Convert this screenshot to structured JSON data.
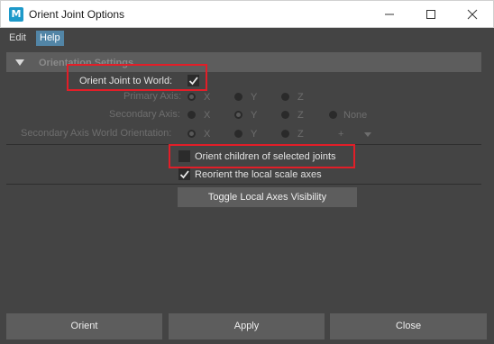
{
  "window": {
    "title": "Orient Joint Options",
    "app_icon": "M"
  },
  "menu": {
    "items": [
      "Edit",
      "Help"
    ],
    "active": "Help"
  },
  "frame": {
    "title": "Orientation Settings",
    "expanded": true
  },
  "orient_to_world": {
    "label": "Orient Joint to World:",
    "checked": true
  },
  "primary_axis": {
    "label": "Primary Axis:",
    "options": [
      "X",
      "Y",
      "Z"
    ],
    "selected": "X"
  },
  "secondary_axis": {
    "label": "Secondary Axis:",
    "options": [
      "X",
      "Y",
      "Z",
      "None"
    ],
    "selected": "Y"
  },
  "secondary_world": {
    "label": "Secondary Axis World Orientation:",
    "options": [
      "X",
      "Y",
      "Z"
    ],
    "selected": "X",
    "sign": "+"
  },
  "orient_children": {
    "label": "Orient children of selected joints",
    "checked": false
  },
  "reorient_scale": {
    "label": "Reorient the local scale axes",
    "checked": true
  },
  "toggle_button": {
    "label": "Toggle Local Axes Visibility"
  },
  "footer": {
    "orient": "Orient",
    "apply": "Apply",
    "close": "Close"
  },
  "colors": {
    "highlight": "#e21e28",
    "menu_active": "#5285a6",
    "panel": "#444444"
  }
}
